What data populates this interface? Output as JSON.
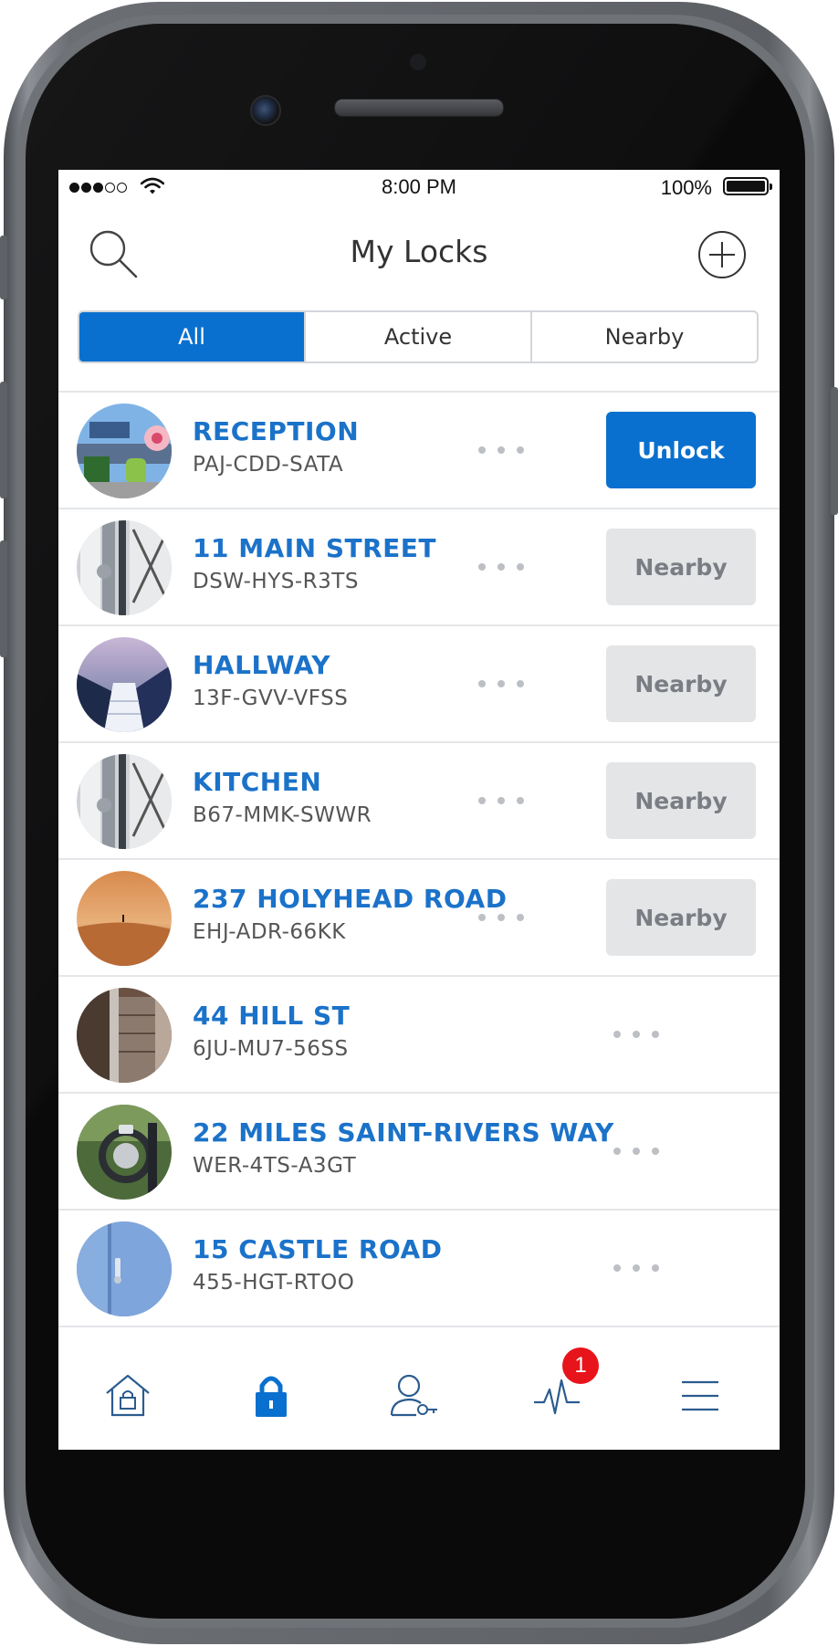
{
  "status_bar": {
    "time": "8:00 PM",
    "battery": "100%"
  },
  "header": {
    "title": "My Locks"
  },
  "filters": [
    {
      "label": "All",
      "active": true
    },
    {
      "label": "Active",
      "active": false
    },
    {
      "label": "Nearby",
      "active": false
    }
  ],
  "locks": [
    {
      "name": "RECEPTION",
      "code": "PAJ-CDD-SATA",
      "action": "Unlock"
    },
    {
      "name": "11 MAIN STREET",
      "code": "DSW-HYS-R3TS",
      "action": "Nearby"
    },
    {
      "name": "HALLWAY",
      "code": "13F-GVV-VFSS",
      "action": "Nearby"
    },
    {
      "name": "KITCHEN",
      "code": "B67-MMK-SWWR",
      "action": "Nearby"
    },
    {
      "name": "237 HOLYHEAD ROAD",
      "code": "EHJ-ADR-66KK",
      "action": "Nearby"
    },
    {
      "name": "44 HILL ST",
      "code": "6JU-MU7-56SS",
      "action": ""
    },
    {
      "name": "22 MILES SAINT-RIVERS WAY",
      "code": "WER-4TS-A3GT",
      "action": ""
    },
    {
      "name": "15 CASTLE ROAD",
      "code": "455-HGT-RTOO",
      "action": ""
    }
  ],
  "tab_bar": {
    "items": [
      "home-lock-icon",
      "padlock-icon",
      "user-key-icon",
      "activity-icon",
      "hamburger-menu-icon"
    ],
    "active": "padlock-icon",
    "activity_badge": "1"
  },
  "colors": {
    "accent": "#0a70cf",
    "link": "#1b72c9",
    "badge": "#e8141b",
    "nearby_bg": "#e4e5e7"
  }
}
